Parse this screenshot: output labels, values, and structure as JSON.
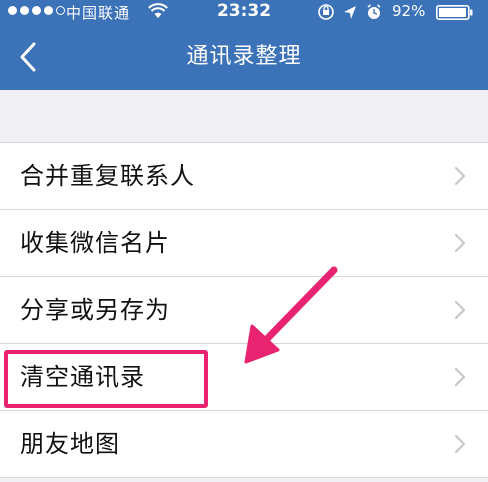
{
  "status_bar": {
    "carrier": "中国联通",
    "time": "23:32",
    "battery": "92%"
  },
  "nav": {
    "back_icon": "chevron-left-icon",
    "title": "通讯录整理"
  },
  "menu": {
    "items": [
      {
        "label": "合并重复联系人"
      },
      {
        "label": "收集微信名片"
      },
      {
        "label": "分享或另存为"
      },
      {
        "label": "清空通讯录"
      },
      {
        "label": "朋友地图"
      }
    ]
  },
  "annotation": {
    "color": "#e8236f",
    "highlighted_item": "清空通讯录"
  },
  "colors": {
    "header": "#3b72b8",
    "background": "#efeff4",
    "chevron": "#c7c7cc"
  }
}
